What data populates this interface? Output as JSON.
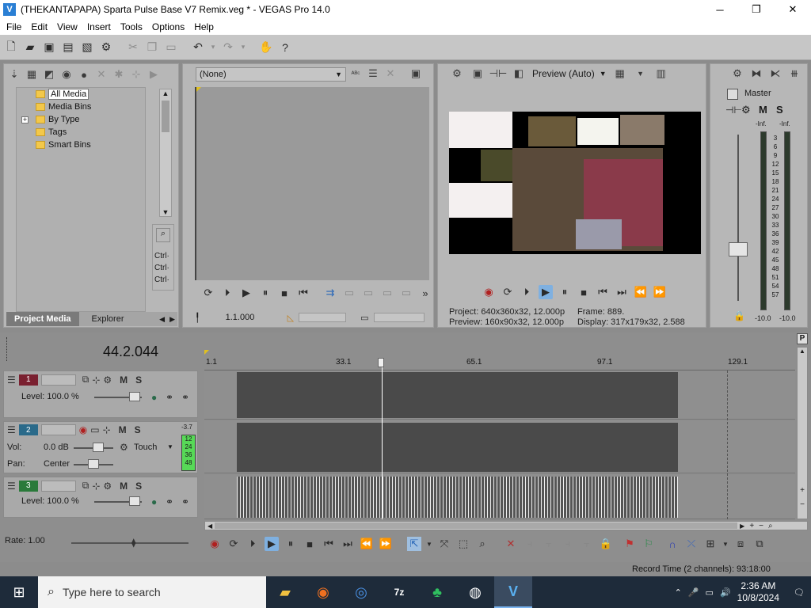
{
  "window": {
    "title": "(THEKANTAPAPA) Sparta Pulse Base V7 Remix.veg * - VEGAS Pro 14.0",
    "minimize": "─",
    "maximize": "❐",
    "close": "✕"
  },
  "menu": [
    "File",
    "Edit",
    "View",
    "Insert",
    "Tools",
    "Options",
    "Help"
  ],
  "project_media": {
    "tree": [
      "All Media",
      "Media Bins",
      "By Type",
      "Tags",
      "Smart Bins"
    ],
    "expander": "+",
    "side_labels": [
      "Ctrl·",
      "Ctrl·",
      "Ctrl·"
    ],
    "tabs": [
      "Project Media",
      "Explorer"
    ]
  },
  "trimmer": {
    "dropdown": "(None)",
    "timecode": "1.1.000"
  },
  "preview": {
    "quality": "Preview (Auto)",
    "project": "Project:  640x360x32, 12.000p",
    "preview": "Preview:  160x90x32, 12.000p",
    "frame": "Frame:   889.",
    "display": "Display:  317x179x32, 2.588"
  },
  "master": {
    "label": "Master",
    "m": "M",
    "s": "S",
    "inf_left": "-Inf.",
    "inf_right": "-Inf.",
    "scale": [
      "3",
      "6",
      "9",
      "12",
      "15",
      "18",
      "21",
      "24",
      "27",
      "30",
      "33",
      "36",
      "39",
      "42",
      "45",
      "48",
      "51",
      "54",
      "57"
    ],
    "bottom_left": "-10.0",
    "bottom_right": "-10.0"
  },
  "timeline": {
    "position": "44.2.044",
    "ruler": [
      "1.1",
      "33.1",
      "65.1",
      "97.1",
      "129.1"
    ],
    "tracks": [
      {
        "num": "1",
        "level": "Level: 100.0 %",
        "m": "M",
        "s": "S"
      },
      {
        "num": "2",
        "vol": "Vol:",
        "vol_value": "0.0 dB",
        "pan": "Pan:",
        "pan_value": "Center",
        "touch": "Touch",
        "m": "M",
        "s": "S",
        "meter_top": "-3.7",
        "meter": [
          "12",
          "24",
          "36",
          "48"
        ]
      },
      {
        "num": "3",
        "level": "Level: 100.0 %",
        "m": "M",
        "s": "S"
      }
    ],
    "rate": "Rate: 1.00",
    "record_time": "Record Time (2 channels): 93:18:00",
    "side_p": "P"
  },
  "taskbar": {
    "search_placeholder": "Type here to search",
    "time": "2:36 AM",
    "date": "10/8/2024"
  },
  "colors": {
    "toolbar_bg": "#c6c6c6",
    "panel_bg": "#b7b7b7",
    "timeline_bg": "#8e8e8e",
    "taskbar_bg": "#1e2b3a",
    "playhead": "#ffffff",
    "track1": "#7a2030",
    "track2": "#2a6a8a",
    "track3": "#2a7a3a",
    "meter_green": "#57d957"
  }
}
